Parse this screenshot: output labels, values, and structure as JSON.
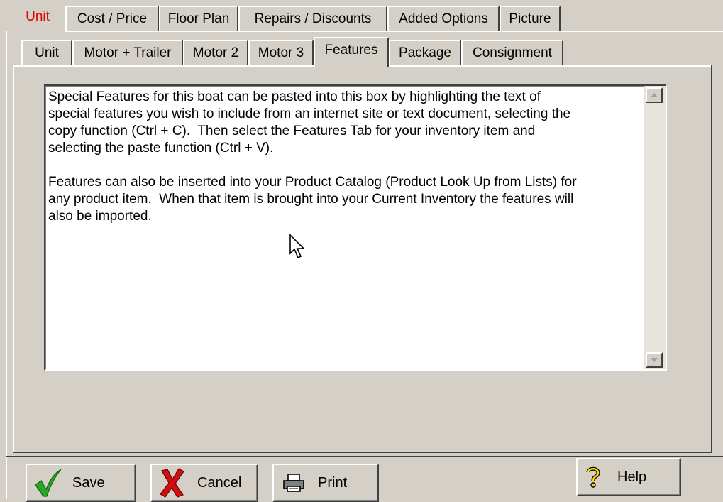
{
  "top_tabs": [
    {
      "label": "Unit"
    },
    {
      "label": "Cost / Price"
    },
    {
      "label": "Floor Plan"
    },
    {
      "label": "Repairs / Discounts"
    },
    {
      "label": "Added Options"
    },
    {
      "label": "Picture"
    }
  ],
  "sub_tabs": [
    {
      "label": "Unit"
    },
    {
      "label": "Motor + Trailer"
    },
    {
      "label": "Motor 2"
    },
    {
      "label": "Motor 3"
    },
    {
      "label": "Features"
    },
    {
      "label": "Package"
    },
    {
      "label": "Consignment"
    }
  ],
  "features_text": "Special Features for this boat can be pasted into this box by highlighting the text of\nspecial features you wish to include from an internet site or text document, selecting the\ncopy function (Ctrl + C).  Then select the Features Tab for your inventory item and\nselecting the paste function (Ctrl + V).\n\nFeatures can also be inserted into your Product Catalog (Product Look Up from Lists) for\nany product item.  When that item is brought into your Current Inventory the features will\nalso be imported.",
  "buttons": {
    "save": "Save",
    "cancel": "Cancel",
    "print": "Print",
    "help": "Help"
  },
  "colors": {
    "active_top_tab": "#e00000",
    "background": "#d4d0c8"
  }
}
